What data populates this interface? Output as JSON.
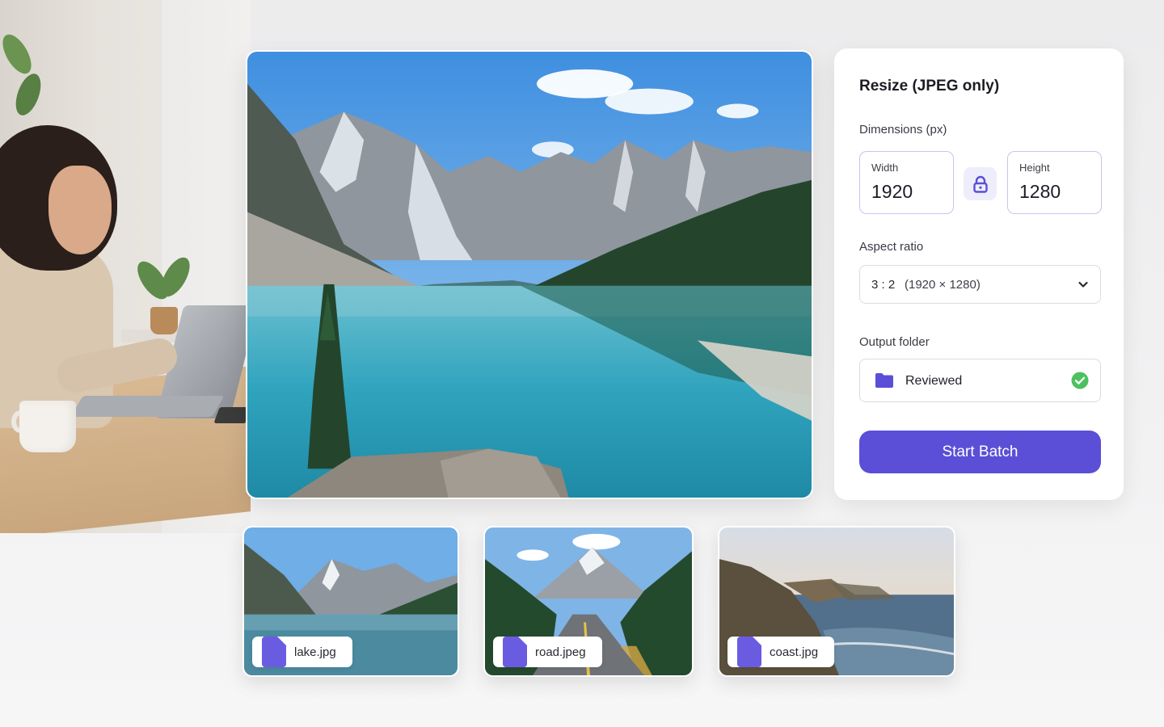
{
  "panel": {
    "title": "Resize (JPEG only)",
    "dimensions_label": "Dimensions (px)",
    "width": {
      "label": "Width",
      "value": "1920"
    },
    "height": {
      "label": "Height",
      "value": "1280"
    },
    "aspect_label": "Aspect ratio",
    "aspect": {
      "ratio": "3 : 2",
      "dims": "(1920 × 1280)"
    },
    "output_label": "Output folder",
    "output_folder": "Reviewed",
    "start_label": "Start Batch"
  },
  "thumbnails": [
    {
      "name": "lake.jpg"
    },
    {
      "name": "road.jpeg"
    },
    {
      "name": "coast.jpg"
    }
  ],
  "colors": {
    "accent": "#5a4fd6",
    "success": "#4cc15e",
    "file_icon": "#6a5ce0"
  },
  "icons": {
    "lock": "lock-icon",
    "chevron": "chevron-down-icon",
    "folder": "folder-icon",
    "check": "check-circle-icon",
    "file": "file-icon"
  }
}
